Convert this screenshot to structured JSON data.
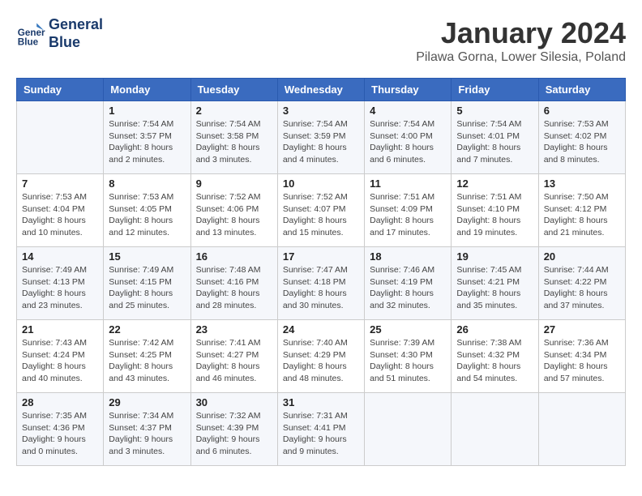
{
  "header": {
    "logo_line1": "General",
    "logo_line2": "Blue",
    "month_year": "January 2024",
    "location": "Pilawa Gorna, Lower Silesia, Poland"
  },
  "weekdays": [
    "Sunday",
    "Monday",
    "Tuesday",
    "Wednesday",
    "Thursday",
    "Friday",
    "Saturday"
  ],
  "weeks": [
    [
      {
        "day": "",
        "info": ""
      },
      {
        "day": "1",
        "info": "Sunrise: 7:54 AM\nSunset: 3:57 PM\nDaylight: 8 hours\nand 2 minutes."
      },
      {
        "day": "2",
        "info": "Sunrise: 7:54 AM\nSunset: 3:58 PM\nDaylight: 8 hours\nand 3 minutes."
      },
      {
        "day": "3",
        "info": "Sunrise: 7:54 AM\nSunset: 3:59 PM\nDaylight: 8 hours\nand 4 minutes."
      },
      {
        "day": "4",
        "info": "Sunrise: 7:54 AM\nSunset: 4:00 PM\nDaylight: 8 hours\nand 6 minutes."
      },
      {
        "day": "5",
        "info": "Sunrise: 7:54 AM\nSunset: 4:01 PM\nDaylight: 8 hours\nand 7 minutes."
      },
      {
        "day": "6",
        "info": "Sunrise: 7:53 AM\nSunset: 4:02 PM\nDaylight: 8 hours\nand 8 minutes."
      }
    ],
    [
      {
        "day": "7",
        "info": "Sunrise: 7:53 AM\nSunset: 4:04 PM\nDaylight: 8 hours\nand 10 minutes."
      },
      {
        "day": "8",
        "info": "Sunrise: 7:53 AM\nSunset: 4:05 PM\nDaylight: 8 hours\nand 12 minutes."
      },
      {
        "day": "9",
        "info": "Sunrise: 7:52 AM\nSunset: 4:06 PM\nDaylight: 8 hours\nand 13 minutes."
      },
      {
        "day": "10",
        "info": "Sunrise: 7:52 AM\nSunset: 4:07 PM\nDaylight: 8 hours\nand 15 minutes."
      },
      {
        "day": "11",
        "info": "Sunrise: 7:51 AM\nSunset: 4:09 PM\nDaylight: 8 hours\nand 17 minutes."
      },
      {
        "day": "12",
        "info": "Sunrise: 7:51 AM\nSunset: 4:10 PM\nDaylight: 8 hours\nand 19 minutes."
      },
      {
        "day": "13",
        "info": "Sunrise: 7:50 AM\nSunset: 4:12 PM\nDaylight: 8 hours\nand 21 minutes."
      }
    ],
    [
      {
        "day": "14",
        "info": "Sunrise: 7:49 AM\nSunset: 4:13 PM\nDaylight: 8 hours\nand 23 minutes."
      },
      {
        "day": "15",
        "info": "Sunrise: 7:49 AM\nSunset: 4:15 PM\nDaylight: 8 hours\nand 25 minutes."
      },
      {
        "day": "16",
        "info": "Sunrise: 7:48 AM\nSunset: 4:16 PM\nDaylight: 8 hours\nand 28 minutes."
      },
      {
        "day": "17",
        "info": "Sunrise: 7:47 AM\nSunset: 4:18 PM\nDaylight: 8 hours\nand 30 minutes."
      },
      {
        "day": "18",
        "info": "Sunrise: 7:46 AM\nSunset: 4:19 PM\nDaylight: 8 hours\nand 32 minutes."
      },
      {
        "day": "19",
        "info": "Sunrise: 7:45 AM\nSunset: 4:21 PM\nDaylight: 8 hours\nand 35 minutes."
      },
      {
        "day": "20",
        "info": "Sunrise: 7:44 AM\nSunset: 4:22 PM\nDaylight: 8 hours\nand 37 minutes."
      }
    ],
    [
      {
        "day": "21",
        "info": "Sunrise: 7:43 AM\nSunset: 4:24 PM\nDaylight: 8 hours\nand 40 minutes."
      },
      {
        "day": "22",
        "info": "Sunrise: 7:42 AM\nSunset: 4:25 PM\nDaylight: 8 hours\nand 43 minutes."
      },
      {
        "day": "23",
        "info": "Sunrise: 7:41 AM\nSunset: 4:27 PM\nDaylight: 8 hours\nand 46 minutes."
      },
      {
        "day": "24",
        "info": "Sunrise: 7:40 AM\nSunset: 4:29 PM\nDaylight: 8 hours\nand 48 minutes."
      },
      {
        "day": "25",
        "info": "Sunrise: 7:39 AM\nSunset: 4:30 PM\nDaylight: 8 hours\nand 51 minutes."
      },
      {
        "day": "26",
        "info": "Sunrise: 7:38 AM\nSunset: 4:32 PM\nDaylight: 8 hours\nand 54 minutes."
      },
      {
        "day": "27",
        "info": "Sunrise: 7:36 AM\nSunset: 4:34 PM\nDaylight: 8 hours\nand 57 minutes."
      }
    ],
    [
      {
        "day": "28",
        "info": "Sunrise: 7:35 AM\nSunset: 4:36 PM\nDaylight: 9 hours\nand 0 minutes."
      },
      {
        "day": "29",
        "info": "Sunrise: 7:34 AM\nSunset: 4:37 PM\nDaylight: 9 hours\nand 3 minutes."
      },
      {
        "day": "30",
        "info": "Sunrise: 7:32 AM\nSunset: 4:39 PM\nDaylight: 9 hours\nand 6 minutes."
      },
      {
        "day": "31",
        "info": "Sunrise: 7:31 AM\nSunset: 4:41 PM\nDaylight: 9 hours\nand 9 minutes."
      },
      {
        "day": "",
        "info": ""
      },
      {
        "day": "",
        "info": ""
      },
      {
        "day": "",
        "info": ""
      }
    ]
  ]
}
